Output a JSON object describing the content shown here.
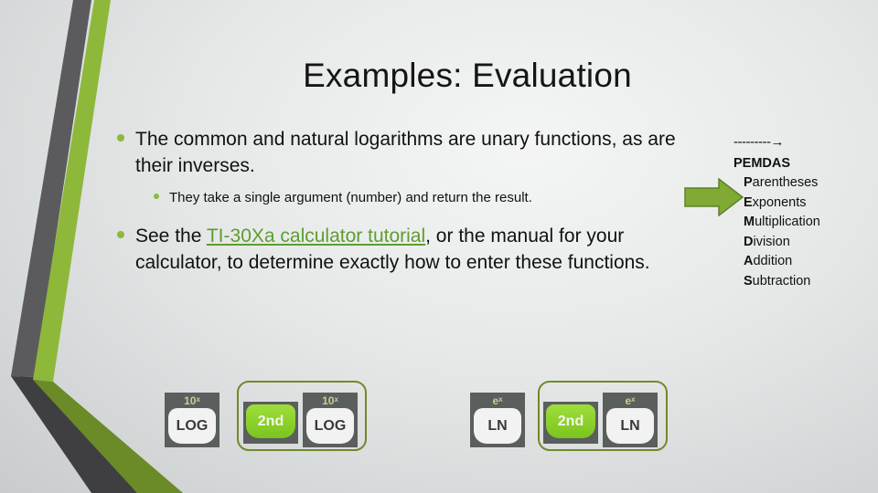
{
  "slide": {
    "title": "Examples: Evaluation",
    "bullets": [
      {
        "text": "The common and natural logarithms are unary functions, as are their inverses.",
        "sub": [
          "They take a single argument (number) and return the result."
        ]
      },
      {
        "pre": "See the ",
        "link": "TI-30Xa calculator tutorial",
        "post": ", or the manual for your calculator, to determine exactly how to enter these functions."
      }
    ]
  },
  "pemdas": {
    "arrow_text": "---------→",
    "heading": "PEMDAS",
    "words": [
      {
        "initial": "P",
        "rest": "arentheses"
      },
      {
        "initial": "E",
        "rest": "xponents"
      },
      {
        "initial": "M",
        "rest": "ultiplication"
      },
      {
        "initial": "D",
        "rest": "ivision"
      },
      {
        "initial": "A",
        "rest": "ddition"
      },
      {
        "initial": "S",
        "rest": "ubtraction"
      }
    ],
    "pointer_target": "Exponents"
  },
  "calculator_keys": {
    "log_key": {
      "label": "LOG",
      "second": "10ˣ"
    },
    "ln_key": {
      "label": "LN",
      "second": "eˣ"
    },
    "second_key": {
      "label": "2nd"
    }
  },
  "colors": {
    "accent_green": "#8db83a",
    "link_green": "#5f9d2f",
    "dark_band": "#5a5a5c"
  }
}
